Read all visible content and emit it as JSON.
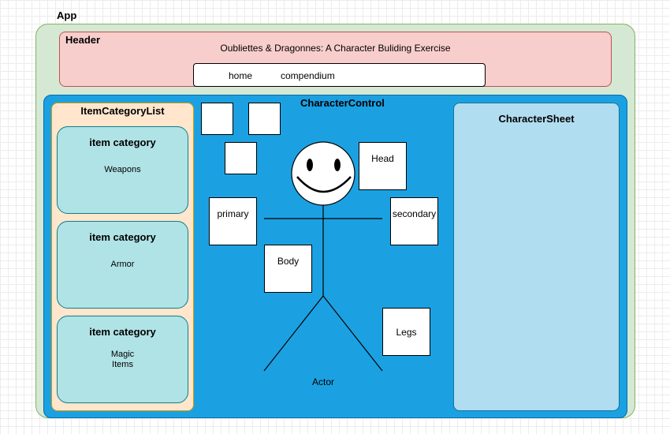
{
  "app": {
    "label": "App"
  },
  "header": {
    "label": "Header",
    "subtitle": "Oubliettes & Dragonnes: A Character Buliding Exercise",
    "nav": {
      "home": "home",
      "compendium": "compendium"
    }
  },
  "character_control": {
    "label": "CharacterControl"
  },
  "item_category_list": {
    "label": "ItemCategoryList",
    "categories": [
      {
        "title": "item category",
        "name": "Weapons"
      },
      {
        "title": "item category",
        "name": "Armor"
      },
      {
        "title": "item category",
        "name_line1": "Magic",
        "name_line2": "Items"
      }
    ]
  },
  "character_sheet": {
    "label": "CharacterSheet"
  },
  "slots": {
    "head": "Head",
    "primary": "primary",
    "secondary": "secondary",
    "body": "Body",
    "legs": "Legs"
  },
  "actor": {
    "label": "Actor",
    "icon": "smiley-face-icon"
  },
  "colors": {
    "app_fill": "#d5e8d4",
    "header_fill": "#f8cecc",
    "control_fill": "#1ba1e2",
    "list_fill": "#ffe6cc",
    "category_fill": "#b0e3e6",
    "sheet_fill": "#b1ddf0"
  }
}
